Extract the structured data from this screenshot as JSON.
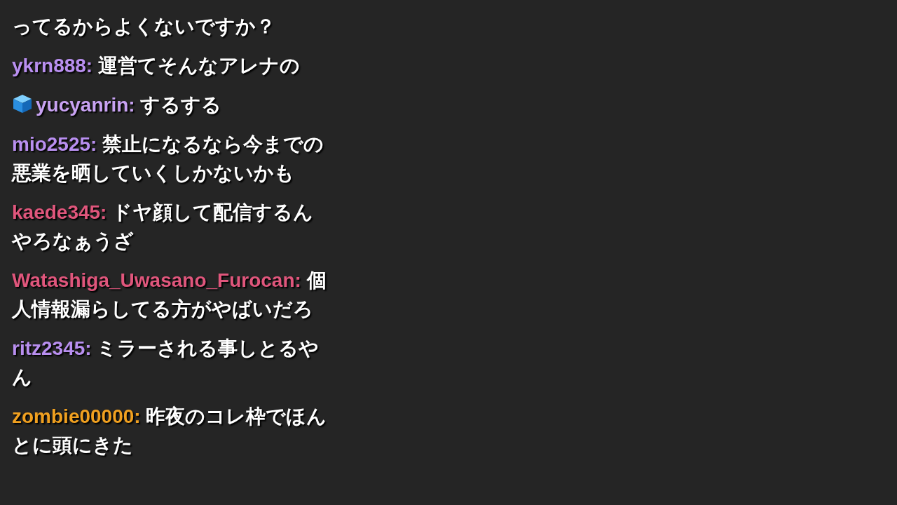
{
  "messages": [
    {
      "kind": "continuation",
      "text": "ってるからよくないですか？"
    },
    {
      "kind": "message",
      "user": "ykrn888:",
      "color": "#b98ff0",
      "badge": false,
      "text": "運営てそんなアレナの"
    },
    {
      "kind": "message",
      "user": "yucyanrin:",
      "color": "#c8a2f2",
      "badge": true,
      "text": "するする"
    },
    {
      "kind": "message",
      "user": "mio2525:",
      "color": "#b98ff0",
      "badge": false,
      "text": "禁止になるなら今までの悪業を晒していくしかないかも"
    },
    {
      "kind": "message",
      "user": "kaede345:",
      "color": "#e0567c",
      "badge": false,
      "text": "ドヤ顔して配信するんやろなぁうざ"
    },
    {
      "kind": "message",
      "user": "Watashiga_Uwasano_Furocan:",
      "color": "#e0567c",
      "badge": false,
      "text": "個人情報漏らしてる方がやばいだろ"
    },
    {
      "kind": "message",
      "user": "ritz2345:",
      "color": "#b98ff0",
      "badge": false,
      "text": "ミラーされる事しとるやん"
    },
    {
      "kind": "message",
      "user": "zombie00000:",
      "color": "#f0a020",
      "badge": false,
      "text": "昨夜のコレ枠でほんとに頭にきた"
    }
  ]
}
